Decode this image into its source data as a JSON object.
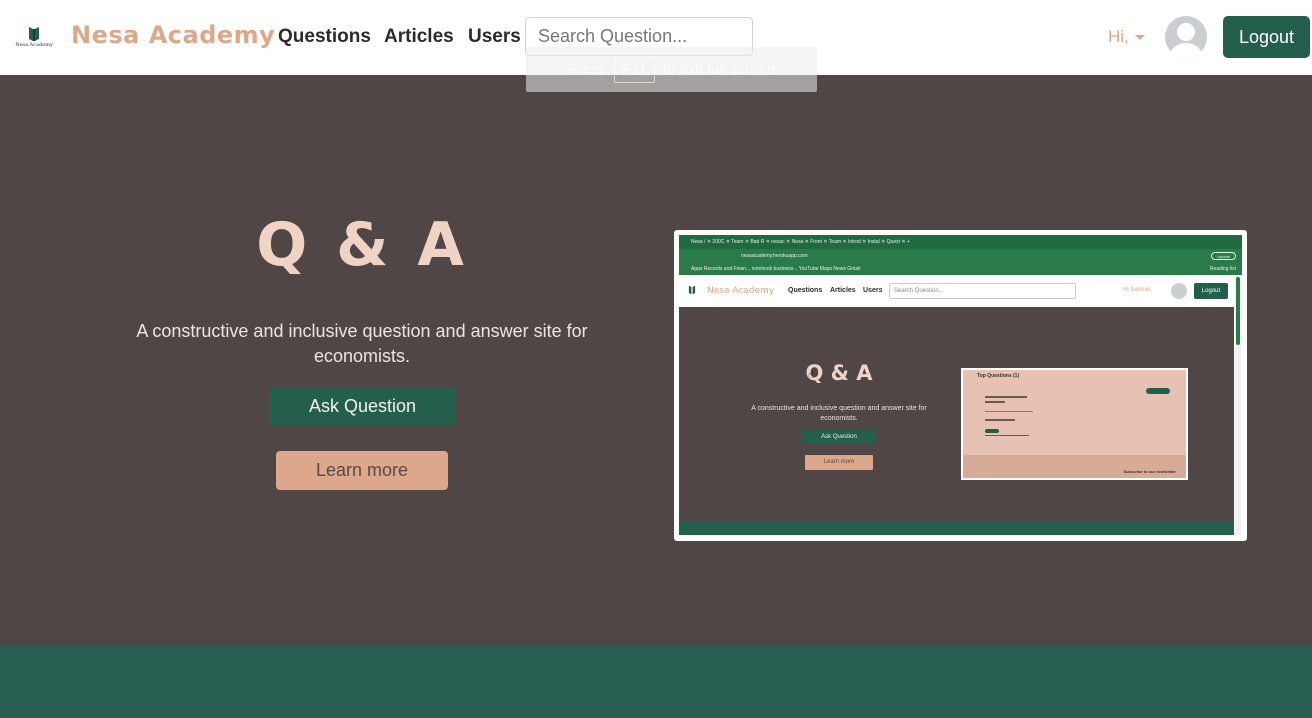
{
  "navbar": {
    "logo_icon": "book-logo-icon",
    "logo_caption": "Nesa Academy",
    "brand": "Nesa Academy",
    "links": [
      "Questions",
      "Articles",
      "Users"
    ],
    "search_placeholder": "Search Question...",
    "greeting": "Hi,",
    "avatar_icon": "user-avatar-icon",
    "logout_label": "Logout"
  },
  "fullscreen_notice": {
    "before": "Press",
    "key": "F11",
    "after": "to exit full screen"
  },
  "hero": {
    "title": "Q & A",
    "tagline": "A constructive and inclusive question and answer site for economists.",
    "ask_button": "Ask Question",
    "learn_button": "Learn more"
  },
  "preview": {
    "tabs": "Nesa /  ✕   200C  ✕   Team  ✕   Bad R  ✕   nesac  ✕   Nesa  ✕   Front  ✕   Team  ✕   Introd  ✕   Instal  ✕   Quest  ✕   +",
    "address": "nesaacademy.herokuapp.com",
    "bookmarks": "Apps    Records and Finan...    notebook business...    YouTube    Maps    News    Gmail",
    "reading_list": "Reading list",
    "update_label": "Update",
    "brand": "Nesa Academy",
    "links": [
      "Questions",
      "Articles",
      "Users"
    ],
    "search_placeholder": "Search Question...",
    "greeting": "Hi Samuel",
    "logout_label": "Logout",
    "title": "Q & A",
    "tagline": "A constructive and inclusive question and answer site for economists.",
    "ask_button": "Ask Question",
    "learn_button": "Learn more",
    "card_title": "Top Questions (1)",
    "card_footer": "Subscribe to our newsletter"
  },
  "colors": {
    "accent_green": "#245e4c",
    "peach": "#dca78a",
    "hero_bg": "#504646",
    "footer_green": "#285e51"
  }
}
